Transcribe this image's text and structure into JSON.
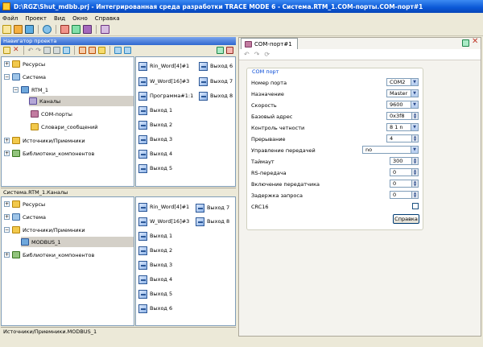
{
  "window": {
    "title": "D:\\RGZ\\Shut_mdbb.prj - Интегрированная среда разработки TRACE MODE 6 - Система.RTM_1.COM-порты.COM-порт#1"
  },
  "menu": [
    "Файл",
    "Проект",
    "Вид",
    "Окно",
    "Справка"
  ],
  "navigator": {
    "title": "Навигатор проекта",
    "top_tree": [
      {
        "label": "Ресурсы",
        "icon": "folder-icon",
        "expander": "+"
      },
      {
        "label": "Система",
        "icon": "system-icon",
        "expander": "−"
      },
      {
        "label": "RTM_1",
        "icon": "node-icon",
        "expander": "−"
      },
      {
        "label": "Каналы",
        "icon": "channels-icon",
        "expander": ""
      },
      {
        "label": "COM-порты",
        "icon": "com-port-icon",
        "expander": ""
      },
      {
        "label": "Словари_сообщений",
        "icon": "dictionary-icon",
        "expander": ""
      },
      {
        "label": "Источники/Приемники",
        "icon": "io-icon",
        "expander": "+"
      },
      {
        "label": "Библиотеки_компонентов",
        "icon": "library-icon",
        "expander": "+"
      }
    ],
    "top_signals_left": [
      "Rin_Word[4]#1",
      "W_Word[16]#3",
      "Программа#1:1",
      "Выход 1",
      "Выход 2",
      "Выход 3",
      "Выход 4",
      "Выход 5"
    ],
    "top_signals_right": [
      "Выход 6",
      "Выход 7",
      "Выход 8"
    ],
    "top_status": "Система.RTM_1.Каналы",
    "bottom_tree": [
      {
        "label": "Ресурсы",
        "icon": "folder-icon",
        "expander": "+"
      },
      {
        "label": "Система",
        "icon": "system-icon",
        "expander": "+"
      },
      {
        "label": "Источники/Приемники",
        "icon": "io-icon",
        "expander": "−"
      },
      {
        "label": "MODBUS_1",
        "icon": "modbus-icon",
        "expander": ""
      },
      {
        "label": "Библиотеки_компонентов",
        "icon": "library-icon",
        "expander": "+"
      }
    ],
    "bottom_signals_left": [
      "Rin_Word[4]#1",
      "W_Word[16]#3",
      "Выход 1",
      "Выход 2",
      "Выход 3",
      "Выход 4",
      "Выход 5",
      "Выход 6"
    ],
    "bottom_signals_right": [
      "Выход 7",
      "Выход 8"
    ],
    "bottom_status": "Источники/Приемники.MODBUS_1"
  },
  "editor": {
    "tab_label": "COM-порт#1",
    "group_title": "COM порт",
    "fields": [
      {
        "label": "Номер порта",
        "value": "COM2",
        "kind": "combo"
      },
      {
        "label": "Назначение",
        "value": "Master",
        "kind": "combo"
      },
      {
        "label": "Скорость",
        "value": "9600",
        "kind": "combo"
      },
      {
        "label": "Базовый адрес",
        "value": "0x3f8",
        "kind": "spin"
      },
      {
        "label": "Контроль четности",
        "value": "8 1 n",
        "kind": "combo"
      },
      {
        "label": "Прерывание",
        "value": "4",
        "kind": "spin"
      },
      {
        "label": "Управление передачей",
        "value": "no",
        "kind": "combo-wide"
      },
      {
        "label": "Таймаут",
        "value": "300",
        "kind": "spin"
      },
      {
        "label": "RS-передача",
        "value": "0",
        "kind": "spin"
      },
      {
        "label": "Включение передатчика",
        "value": "0",
        "kind": "spin"
      },
      {
        "label": "Задержка запроса",
        "value": "0",
        "kind": "spin"
      },
      {
        "label": "CRC16",
        "value": "",
        "kind": "check"
      }
    ],
    "help_button": "Справка"
  },
  "colors": {
    "titlebar": "#0a57d6",
    "panel_title": "#2f68d0",
    "background": "#ece9d8"
  }
}
